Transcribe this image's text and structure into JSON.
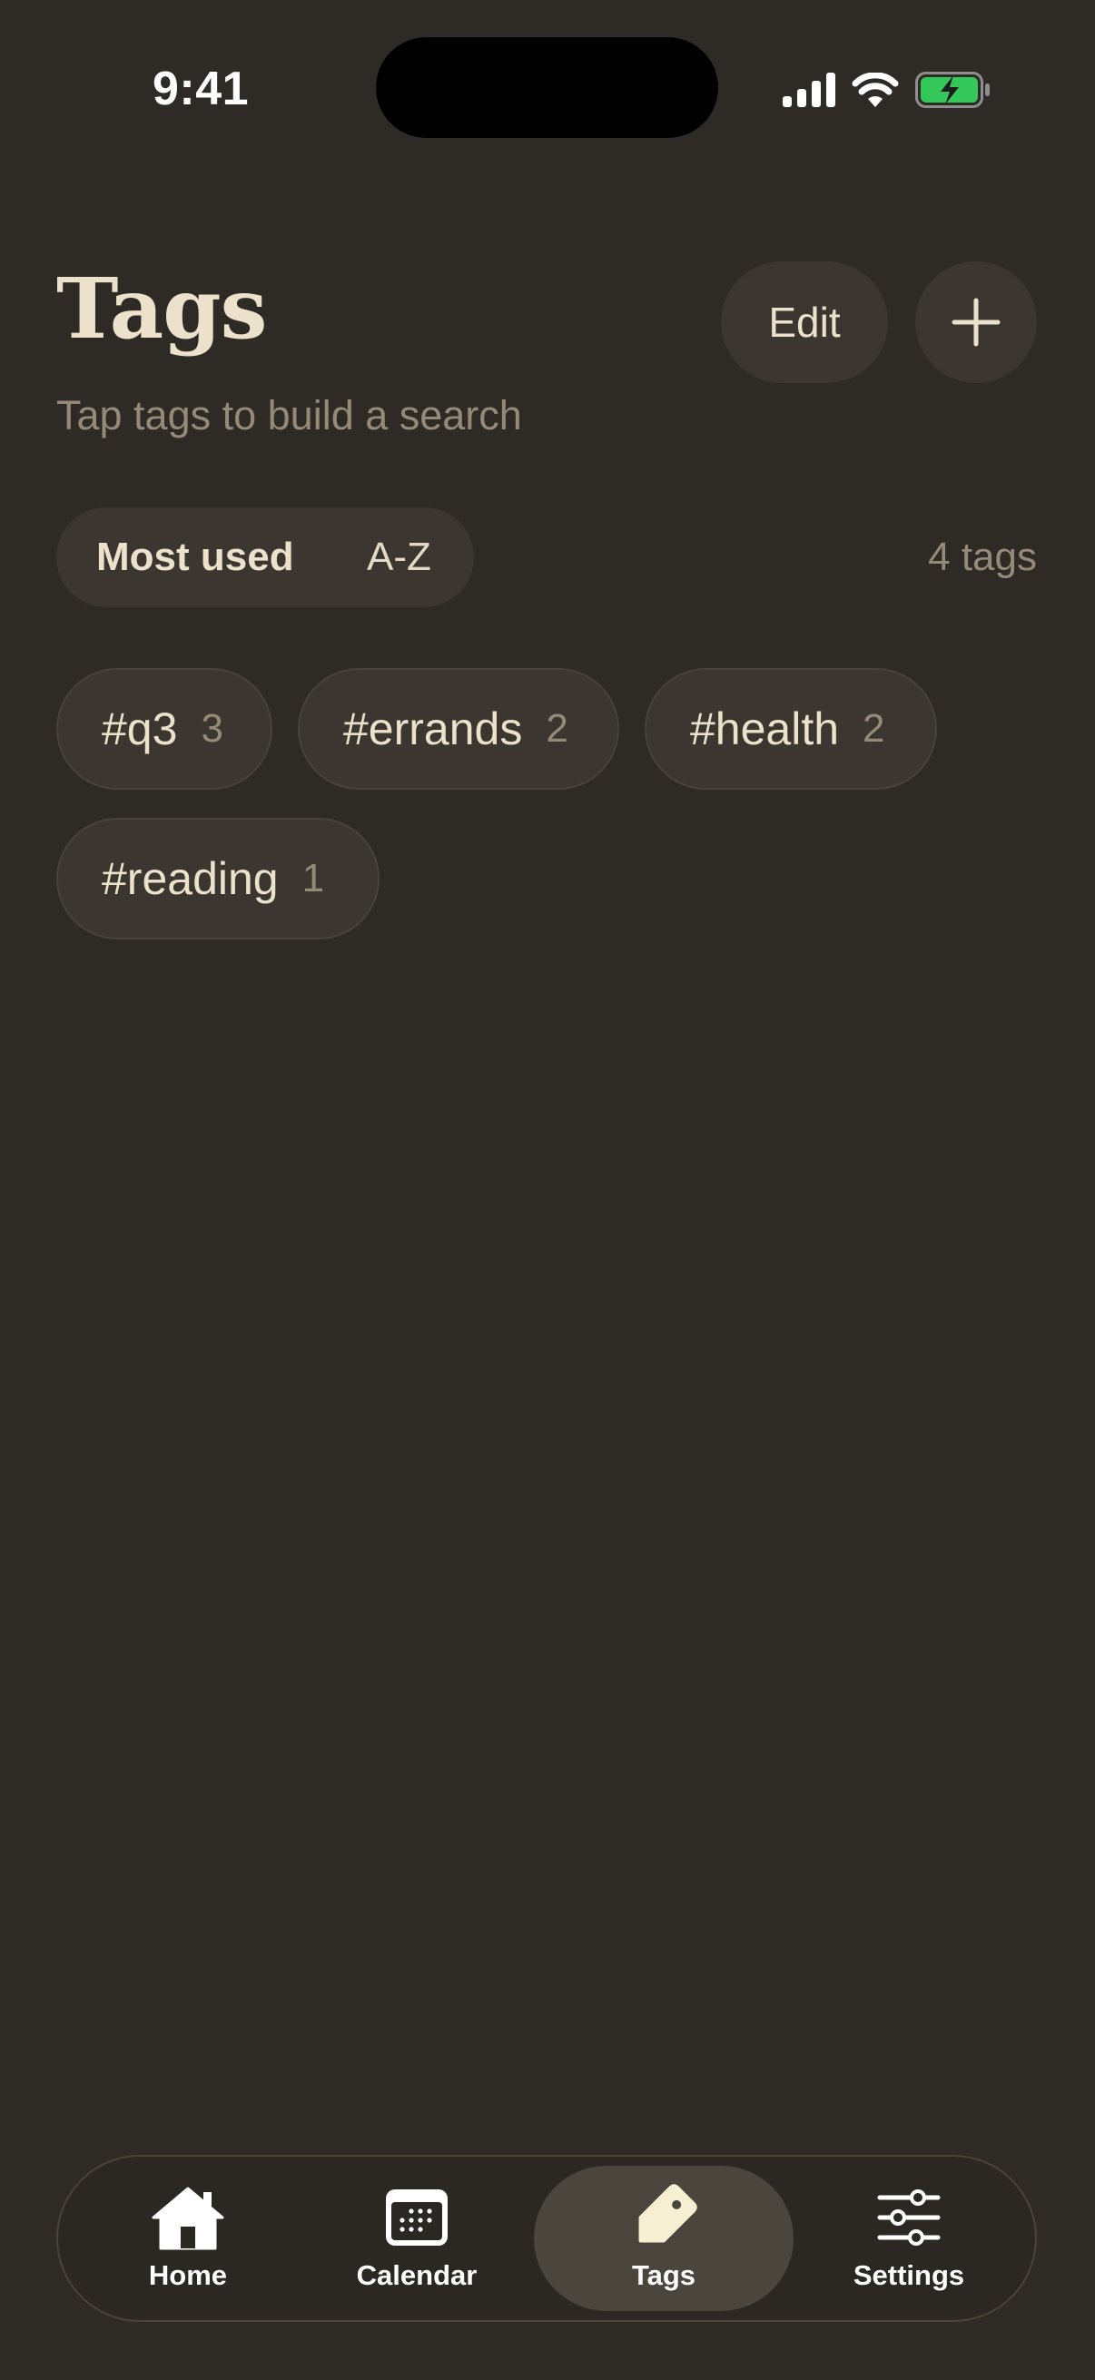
{
  "status_bar": {
    "time": "9:41"
  },
  "header": {
    "title": "Tags",
    "subtitle": "Tap tags to build a search",
    "edit_label": "Edit"
  },
  "sort": {
    "options": [
      {
        "label": "Most used",
        "selected": true
      },
      {
        "label": "A-Z",
        "selected": false
      }
    ],
    "count_label": "4 tags"
  },
  "tags": [
    {
      "name": "#q3",
      "count": "3"
    },
    {
      "name": "#errands",
      "count": "2"
    },
    {
      "name": "#health",
      "count": "2"
    },
    {
      "name": "#reading",
      "count": "1"
    }
  ],
  "tab_bar": {
    "items": [
      {
        "label": "Home",
        "icon": "house-icon",
        "active": false
      },
      {
        "label": "Calendar",
        "icon": "calendar-icon",
        "active": false
      },
      {
        "label": "Tags",
        "icon": "tag-icon",
        "active": true
      },
      {
        "label": "Settings",
        "icon": "sliders-icon",
        "active": false
      }
    ]
  },
  "colors": {
    "background": "#2e2a25",
    "surface": "#3b362f",
    "text_primary": "#ece2cc",
    "text_secondary": "#958a78",
    "battery_green": "#34c759",
    "tab_active": "#4a453d"
  }
}
